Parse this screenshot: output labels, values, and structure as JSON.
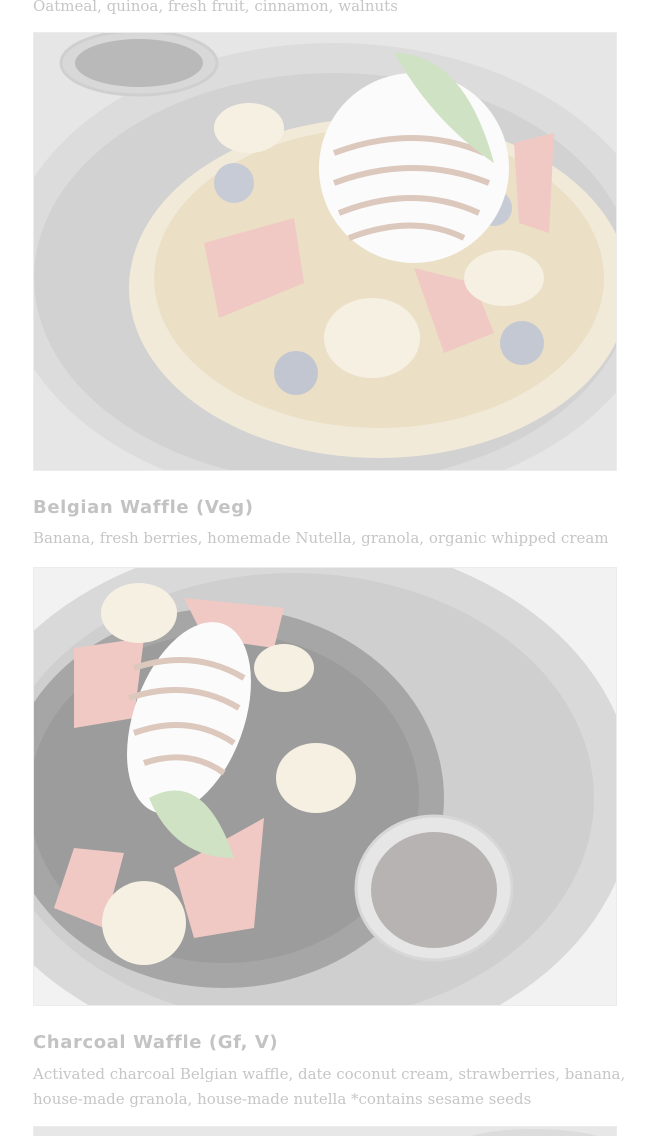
{
  "menu_items": [
    {
      "description": "Oatmeal, quinoa, fresh fruit, cinnamon, walnuts"
    },
    {
      "title": "Belgian Waffle (Veg)",
      "description": "Banana, fresh berries, homemade Nutella, granola, organic whipped cream",
      "photo": "belgian-waffle-photo"
    },
    {
      "title": "Charcoal Waffle (Gf, V)",
      "description_lines": [
        "Activated charcoal Belgian waffle, date coconut cream, strawberries, banana,",
        "house-made granola, house-made nutella *contains sesame seeds"
      ],
      "photo": "charcoal-waffle-photo"
    }
  ],
  "colors": {
    "text_faded": "#c3c3c3",
    "background": "#ffffff"
  }
}
